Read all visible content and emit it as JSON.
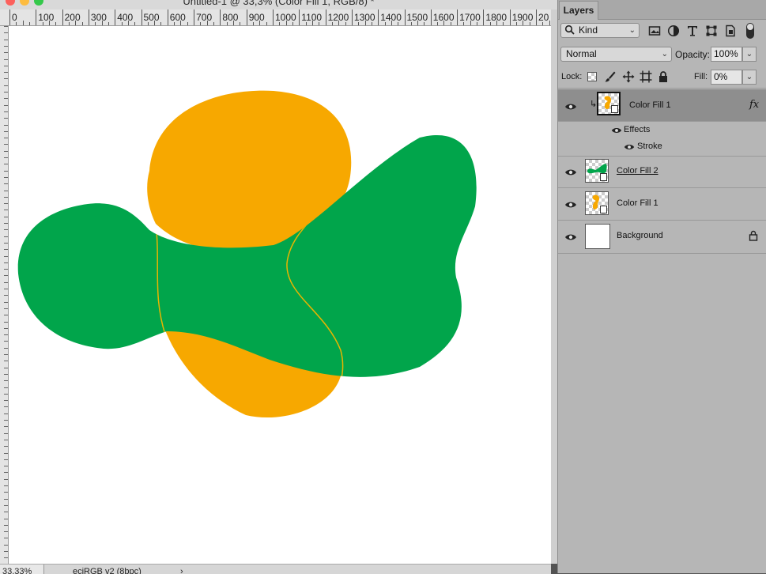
{
  "window": {
    "title": "Untitled-1 @ 33,3% (Color Fill 1, RGB/8) *"
  },
  "ruler": {
    "labels": [
      "0",
      "100",
      "200",
      "300",
      "400",
      "500",
      "600",
      "700",
      "800",
      "900",
      "1000",
      "1100",
      "1200",
      "1300",
      "1400",
      "1500",
      "1600",
      "1700",
      "1800",
      "1900",
      "20"
    ]
  },
  "status": {
    "zoom": "33,33%",
    "doc_info": "eciRGB v2 (8bpc)",
    "arrow": "›"
  },
  "colors": {
    "orange": "#f7a800",
    "green": "#01a54b",
    "stroke": "#e8b400",
    "canvas": "#ffffff"
  },
  "panel": {
    "tab": "Layers",
    "filter": {
      "value": "Kind",
      "icon": "search-icon"
    },
    "blend_mode": "Normal",
    "opacity_label": "Opacity:",
    "opacity_value": "100%",
    "lock_label": "Lock:",
    "fill_label": "Fill:",
    "fill_value": "0%",
    "layers": [
      {
        "name": "Color Fill 1",
        "selected": true,
        "clipped": true,
        "fx": "fx",
        "effects_label": "Effects",
        "effect": "Stroke"
      },
      {
        "name": "Color Fill 2",
        "selected": false,
        "underlined": true
      },
      {
        "name": "Color Fill 1",
        "selected": false
      },
      {
        "name": "Background",
        "selected": false,
        "locked": true
      }
    ]
  }
}
